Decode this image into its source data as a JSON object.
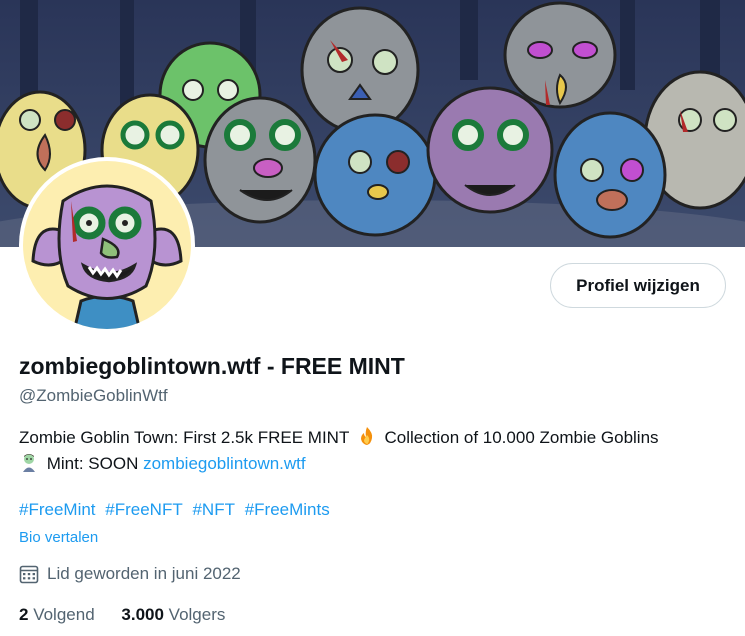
{
  "profile": {
    "display_name": "zombiegoblintown.wtf - FREE MINT",
    "handle": "@ZombieGoblinWtf",
    "edit_button_label": "Profiel wijzigen",
    "bio_line1": "Zombie Goblin Town: First 2.5k FREE MINT",
    "bio_line1_end": "Collection of 10.000 Zombie Goblins",
    "bio_line2": "Mint: SOON",
    "bio_link": "zombiegoblintown.wtf",
    "hashtags": [
      "#FreeMint",
      "#FreeNFT",
      "#NFT",
      "#FreeMints"
    ],
    "translate_label": "Bio vertalen",
    "joined_text": "Lid geworden in juni 2022",
    "following_count": "2",
    "following_label": "Volgend",
    "followers_count": "3.000",
    "followers_label": "Volgers"
  },
  "icons": {
    "emoji1": "fire-emoji",
    "emoji2": "zombie-emoji",
    "joined": "calendar-icon"
  },
  "colors": {
    "link": "#1d9bf0",
    "secondary_text": "#536471",
    "avatar_background": "#fdeeb0",
    "banner_background": "#2c3a5c"
  }
}
